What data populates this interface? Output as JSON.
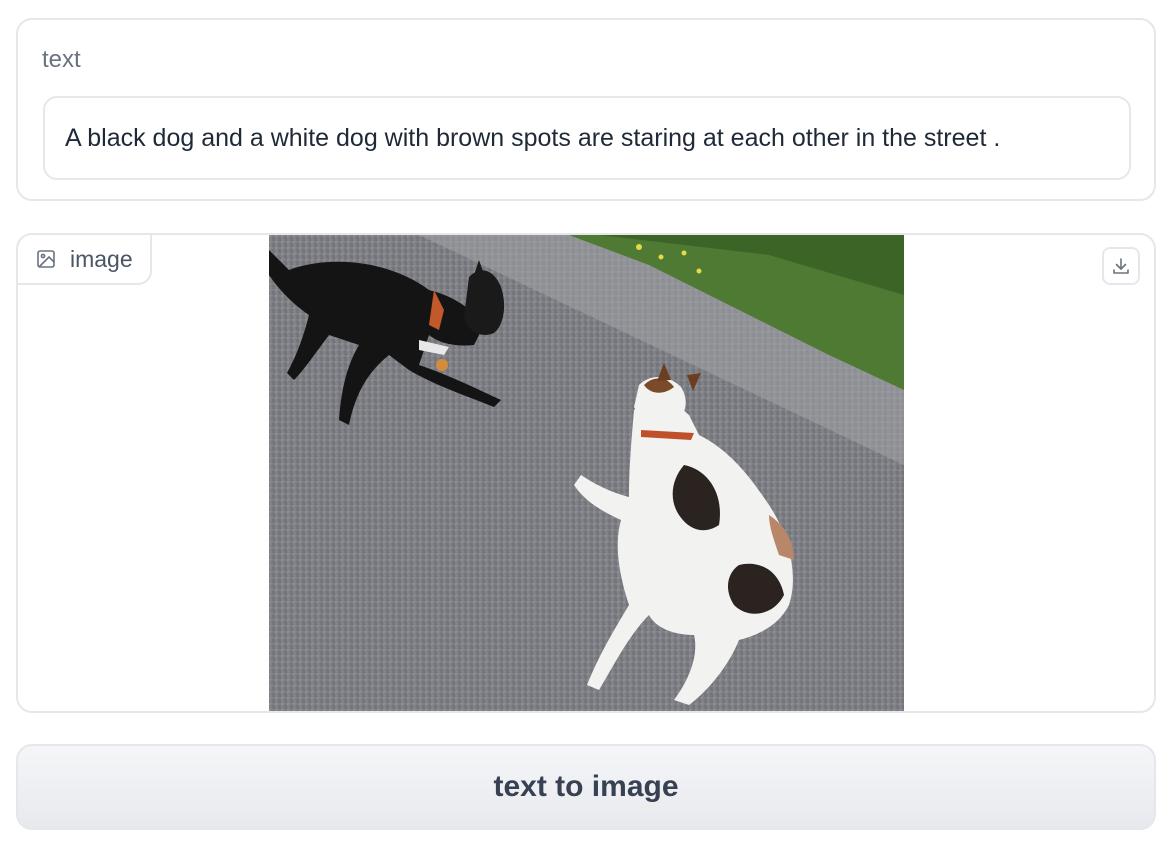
{
  "text_panel": {
    "label": "text",
    "value": "A black dog and a white dog with brown spots are staring at each other in the street ."
  },
  "image_panel": {
    "label": "image",
    "label_icon": "image-icon",
    "download_icon": "download-icon"
  },
  "action": {
    "button_label": "text to image"
  },
  "colors": {
    "border": "#e6e7eb",
    "label_text": "#6b7280",
    "body_text": "#1f2937",
    "button_text": "#374151"
  }
}
